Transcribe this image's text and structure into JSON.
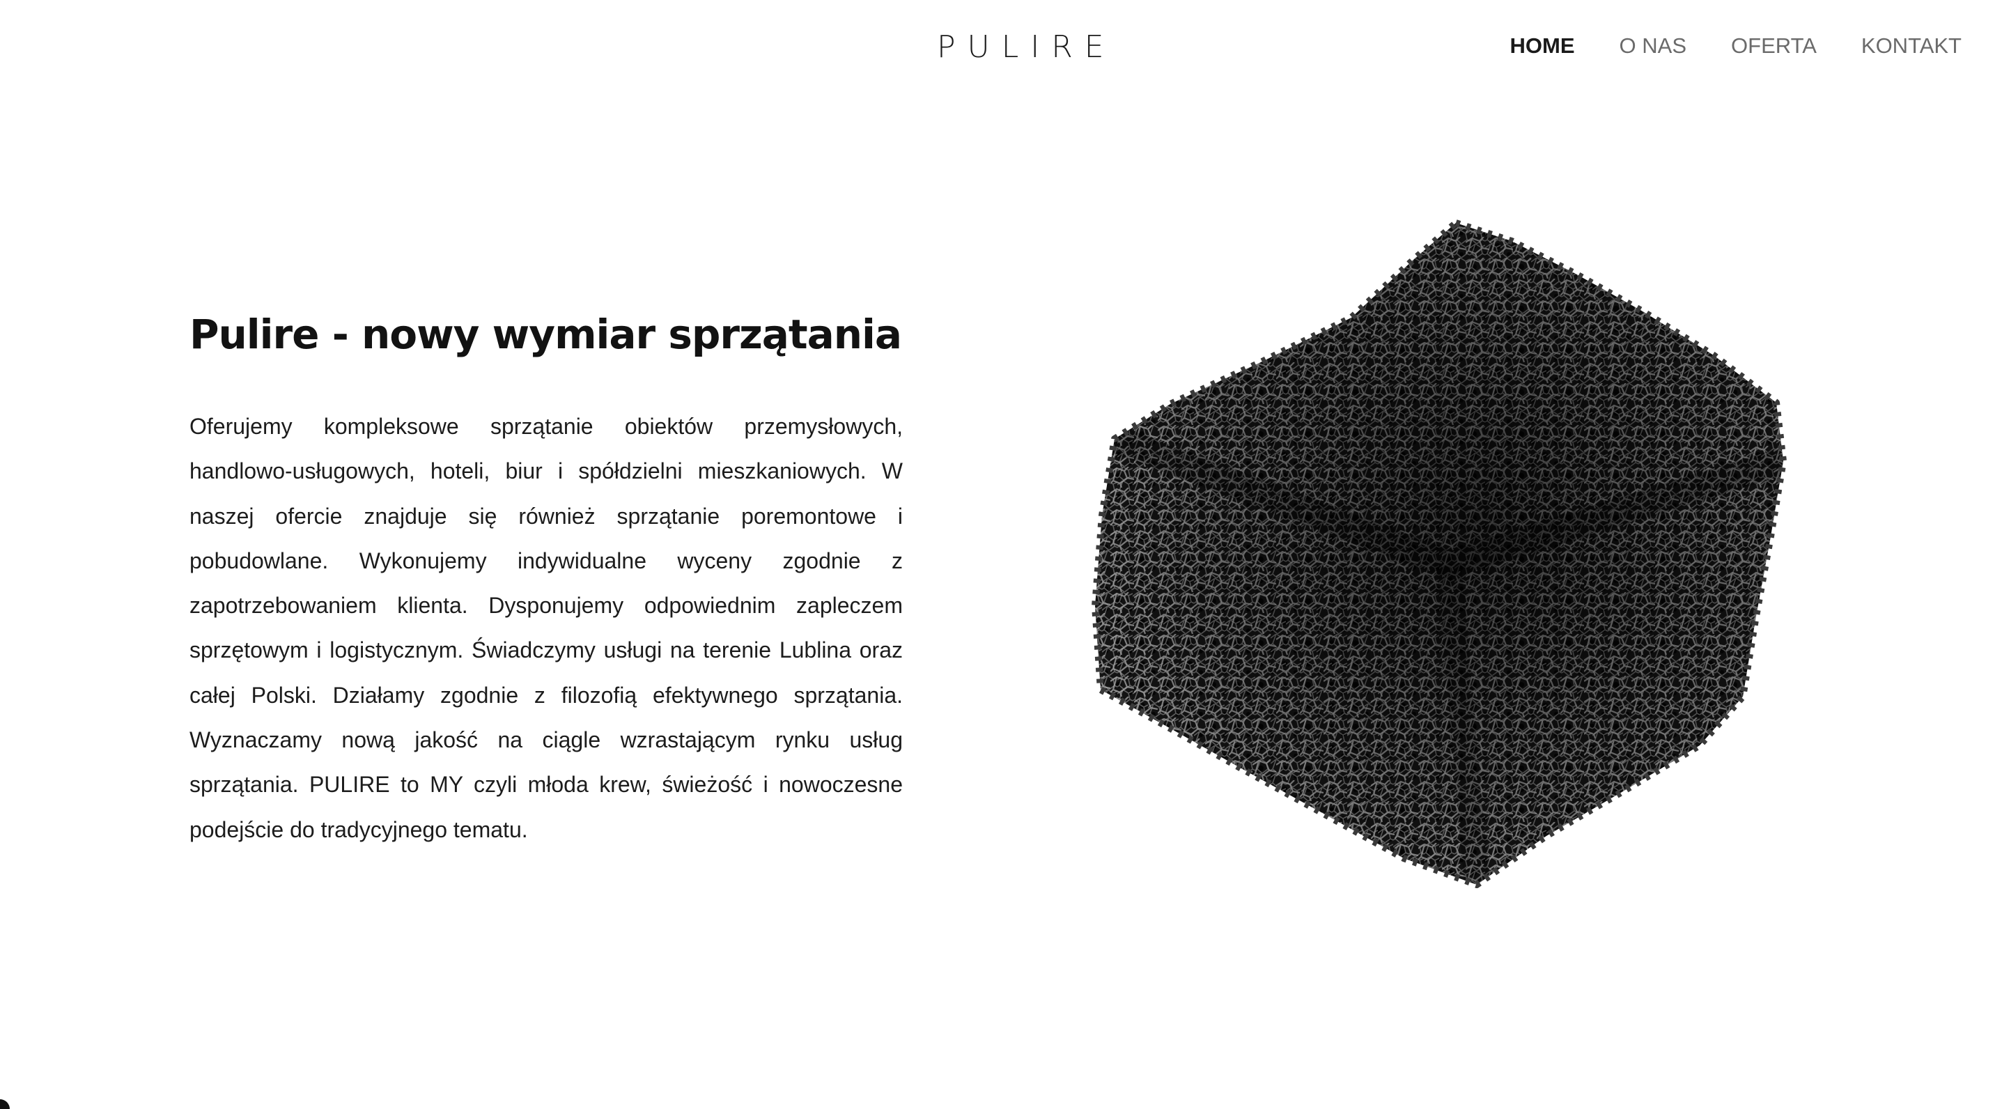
{
  "header": {
    "logo": "PULIRE",
    "nav": [
      {
        "label": "HOME",
        "active": true
      },
      {
        "label": "O NAS",
        "active": false
      },
      {
        "label": "OFERTA",
        "active": false
      },
      {
        "label": "KONTAKT",
        "active": false
      }
    ]
  },
  "hero": {
    "title": "Pulire - nowy wymiar sprzątania",
    "body": "Oferujemy kompleksowe sprzątanie obiektów przemysłowych, handlowo-usługowych, hoteli, biur i spółdzielni mieszkaniowych. W naszej ofercie znajduje się również sprzątanie poremontowe i pobudowlane. Wykonujemy indywidualne wyceny zgodnie z zapotrzebowaniem klienta. Dysponujemy odpowiednim zapleczem sprzętowym i logistycznym. Świadczymy usługi na terenie Lublina oraz całej Polski. Działamy zgodnie z filozofią efektywnego sprzątania. Wyznaczamy nową jakość na ciągle wzrastającym rynku usług sprzątania. PULIRE to MY czyli młoda krew, świeżość i nowoczesne podejście do tradycyjnego tematu.",
    "image": {
      "icon": "black-sponge-image"
    }
  },
  "colors": {
    "background": "#ffffff",
    "text": "#151515",
    "nav_inactive": "#6a6a6a",
    "sponge": "#1b1b1b"
  }
}
